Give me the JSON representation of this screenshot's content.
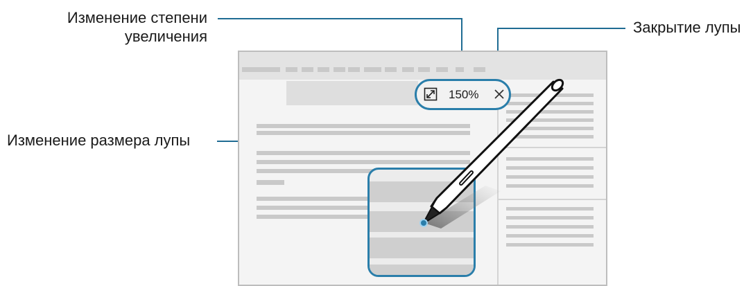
{
  "labels": {
    "zoom_change_line1": "Изменение степени",
    "zoom_change_line2": "увеличения",
    "resize": "Изменение размера лупы",
    "close": "Закрытие лупы"
  },
  "magnifier_toolbar": {
    "zoom_level": "150%",
    "resize_icon": "resize-arrows-icon",
    "close_icon": "close-icon"
  },
  "colors": {
    "accent": "#2a7eaa",
    "callout_line": "#1f6c93",
    "screen_bg": "#f4f4f4",
    "placeholder": "#c9c9c9"
  }
}
